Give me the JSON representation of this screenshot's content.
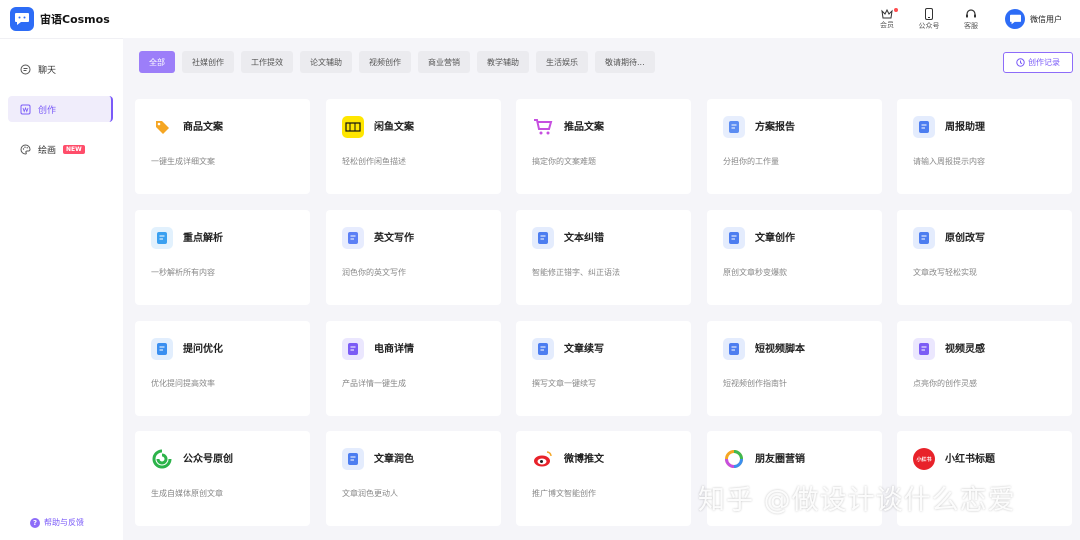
{
  "app": {
    "name": "宙语Cosmos"
  },
  "header": {
    "items": [
      {
        "label": "会员",
        "icon": "crown-icon"
      },
      {
        "label": "公众号",
        "icon": "phone-icon"
      },
      {
        "label": "客服",
        "icon": "headset-icon"
      }
    ],
    "user_name": "微信用户"
  },
  "sidebar": {
    "items": [
      {
        "label": "聊天",
        "icon": "chat-icon"
      },
      {
        "label": "创作",
        "icon": "write-icon"
      },
      {
        "label": "绘画",
        "icon": "palette-icon",
        "badge": "NEW"
      }
    ],
    "active_index": 1,
    "help_label": "帮助与反馈"
  },
  "tabs": [
    "全部",
    "社媒创作",
    "工作提效",
    "论文辅助",
    "视频创作",
    "商业营销",
    "教学辅助",
    "生活娱乐",
    "敬请期待..."
  ],
  "active_tab": 0,
  "history_label": "创作记录",
  "cards": [
    {
      "title": "商品文案",
      "desc": "一键生成详细文案",
      "icon": "tag-icon",
      "color": "#f5a623"
    },
    {
      "title": "闲鱼文案",
      "desc": "轻松创作闲鱼描述",
      "icon": "xianyu-icon",
      "color": "#ffe600"
    },
    {
      "title": "推品文案",
      "desc": "搞定你的文案难题",
      "icon": "cart-icon",
      "color": "#c64fe0"
    },
    {
      "title": "方案报告",
      "desc": "分担你的工作量",
      "icon": "report-icon",
      "color": "#5b8cf2"
    },
    {
      "title": "周报助理",
      "desc": "请输入周报提示内容",
      "icon": "weekly-report-icon",
      "color": "#4c7df0"
    },
    {
      "title": "重点解析",
      "desc": "一秒解析所有内容",
      "icon": "analysis-icon",
      "color": "#3aa0f0"
    },
    {
      "title": "英文写作",
      "desc": "润色你的英文写作",
      "icon": "english-pen-icon",
      "color": "#5b7ff5"
    },
    {
      "title": "文本纠错",
      "desc": "智能修正错字、纠正语法",
      "icon": "correct-doc-icon",
      "color": "#4c7df0"
    },
    {
      "title": "文章创作",
      "desc": "原创文章秒变爆款",
      "icon": "article-icon",
      "color": "#4c7df0"
    },
    {
      "title": "原创改写",
      "desc": "文章改写轻松实现",
      "icon": "rewrite-icon",
      "color": "#4c7df0"
    },
    {
      "title": "提问优化",
      "desc": "优化提问提高效率",
      "icon": "question-icon",
      "color": "#3a8ff0"
    },
    {
      "title": "电商详情",
      "desc": "产品详情一键生成",
      "icon": "shop-bag-icon",
      "color": "#7b5cf5"
    },
    {
      "title": "文章续写",
      "desc": "撰写文章一键续写",
      "icon": "continue-doc-icon",
      "color": "#4c7df0"
    },
    {
      "title": "短视频脚本",
      "desc": "短视频创作指南针",
      "icon": "script-icon",
      "color": "#4c7df0"
    },
    {
      "title": "视频灵感",
      "desc": "点亮你的创作灵感",
      "icon": "video-icon",
      "color": "#7b5cf5"
    },
    {
      "title": "公众号原创",
      "desc": "生成自媒体原创文章",
      "icon": "official-account-icon",
      "color": "#2cb34a"
    },
    {
      "title": "文章润色",
      "desc": "文章润色更动人",
      "icon": "polish-icon",
      "color": "#4c7df0"
    },
    {
      "title": "微博推文",
      "desc": "推广博文智能创作",
      "icon": "weibo-icon",
      "color": "#f5a623"
    },
    {
      "title": "朋友圈营销",
      "desc": "",
      "icon": "moments-icon",
      "color": "#f5a623"
    },
    {
      "title": "小红书标题",
      "desc": "",
      "icon": "xiaohongshu-icon",
      "color": "#e8222a",
      "icon_text": "小红书"
    }
  ],
  "watermark": "知乎 @做设计谈什么恋爱"
}
